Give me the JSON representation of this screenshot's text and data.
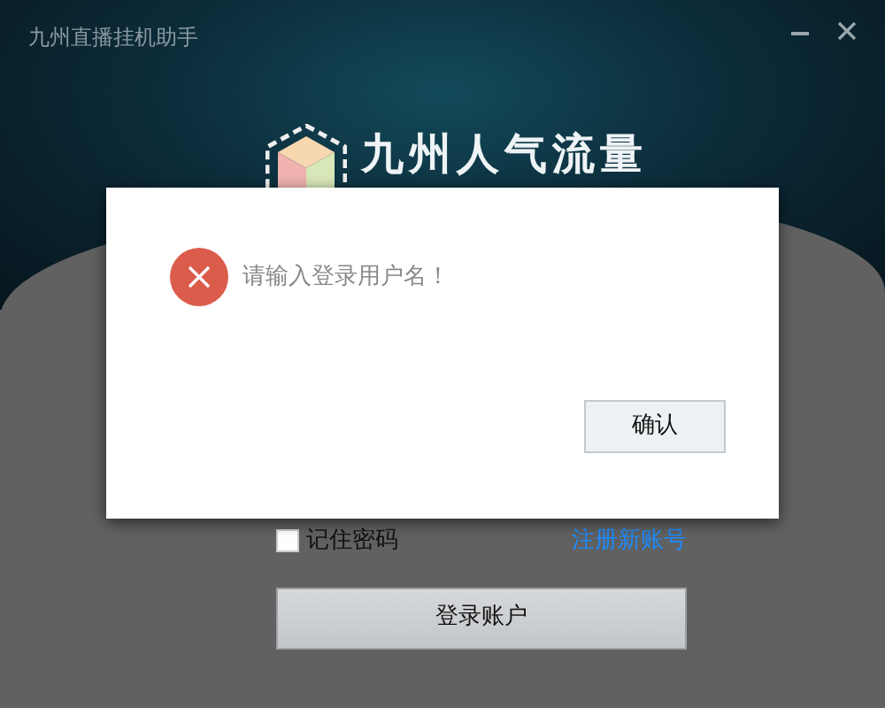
{
  "window": {
    "title": "九州直播挂机助手"
  },
  "logo": {
    "title": "九州人气流量"
  },
  "login": {
    "remember": {
      "label": "记住密码",
      "checked": false
    },
    "register_link": "注册新账号",
    "login_button": "登录账户"
  },
  "dialog": {
    "message": "请输入登录用户名！",
    "confirm_button": "确认"
  }
}
